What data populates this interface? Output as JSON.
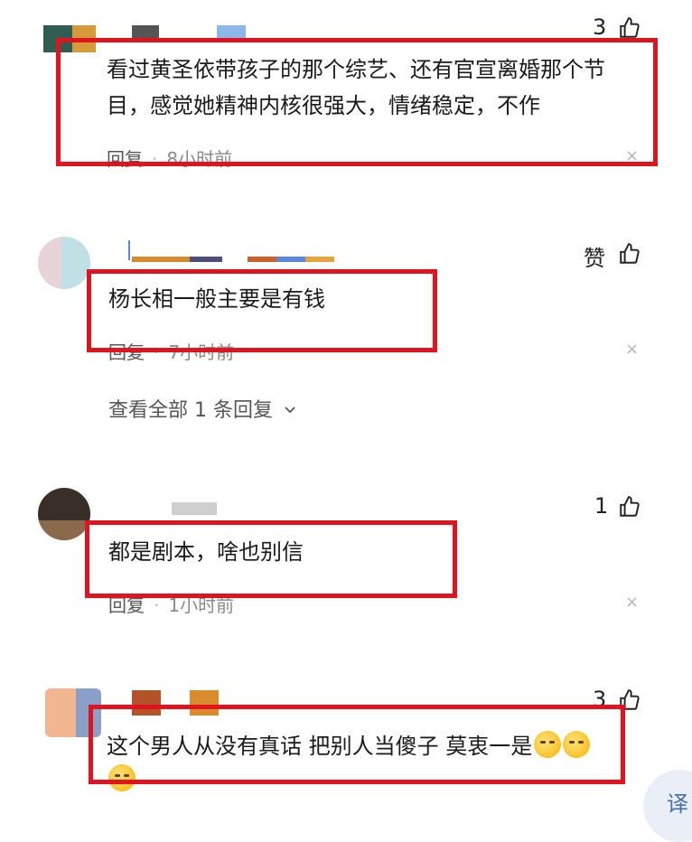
{
  "comments": [
    {
      "likes": "3",
      "text_line1": "看过黄圣依带孩子的那个综艺、还有官宣离婚那个节",
      "text_line2": "目，感觉她精神内核很强大，情绪稳定，不作",
      "reply_label": "回复",
      "time": "8小时前",
      "close": "×"
    },
    {
      "likes": "赞",
      "text_line1": "杨长相一般主要是有钱",
      "reply_label": "回复",
      "time": "7小时前",
      "close": "×",
      "view_all": "查看全部 1 条回复"
    },
    {
      "likes": "1",
      "text_line1": "都是剧本，啥也别信",
      "reply_label": "回复",
      "time": "1小时前",
      "close": "×"
    },
    {
      "likes": "3",
      "text_line1": "这个男人从没有真话 把别人当傻子 莫衷一是"
    }
  ],
  "translate_button": "译",
  "colors": {
    "highlight": "#e0141e",
    "meta": "#8a8a8a"
  }
}
